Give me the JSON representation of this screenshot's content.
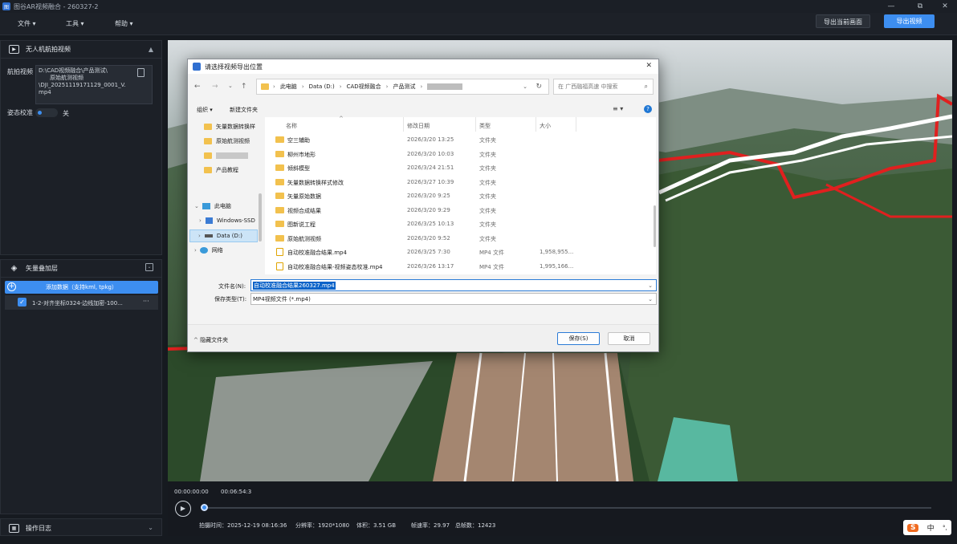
{
  "app": {
    "title": "图谷AR视频融合 - 260327-2"
  },
  "menu": {
    "items": [
      "文件 ▾",
      "工具 ▾",
      "帮助 ▾"
    ]
  },
  "top_buttons": {
    "export_frame": "导出当前画面",
    "export_video": "导出视频"
  },
  "panel_video": {
    "title": "无人机航拍视频",
    "video_label": "航拍视频",
    "video_path_lines": [
      "D:\\CAD视频融合\\产品测试\\",
      "原始航测视频",
      "\\DJI_20251119171129_0001_V.",
      "mp4"
    ],
    "attitude_label": "姿态校准",
    "attitude_state": "关"
  },
  "panel_layers": {
    "title": "矢量叠加层",
    "add_button": "添加数据（支持kml, tpkg）",
    "layer_item": "1-2-对齐坐标0324-边线加密-100...",
    "layer_more": "···"
  },
  "panel_log": {
    "title": "操作日志"
  },
  "player": {
    "current_time": "00:00:00:00",
    "total_time": "00:06:54:3",
    "progress": 0.0,
    "info": {
      "capture_time": "拍摄时间：2025-12-19 08:16:36",
      "resolution": "分辨率：1920*1080",
      "size": "体积：3.51 GB",
      "fps": "帧速率：29.97",
      "frames": "总帧数：12423"
    }
  },
  "dialog": {
    "title": "请选择视频导出位置",
    "address": [
      "此电脑",
      "Data (D:)",
      "CAD视频融合",
      "产品测试"
    ],
    "search_placeholder": "在 广西融福高速 中搜索",
    "toolbar": {
      "organize": "组织 ▾",
      "new_folder": "新建文件夹"
    },
    "nav": [
      {
        "label": "矢量数据转换样",
        "type": "folder"
      },
      {
        "label": "原始航测视频",
        "type": "folder"
      },
      {
        "label": "",
        "type": "folder"
      },
      {
        "label": "产品教程",
        "type": "folder"
      },
      {
        "label": "此电脑",
        "type": "pc"
      },
      {
        "label": "Windows-SSD",
        "type": "drive"
      },
      {
        "label": "Data (D:)",
        "type": "drive"
      },
      {
        "label": "网络",
        "type": "network"
      }
    ],
    "columns": [
      "名称",
      "修改日期",
      "类型",
      "大小"
    ],
    "files": [
      {
        "name": "空三辅助",
        "date": "2026/3/20 13:25",
        "type": "文件夹",
        "size": "",
        "kind": "folder"
      },
      {
        "name": "柳州市地形",
        "date": "2026/3/20 10:03",
        "type": "文件夹",
        "size": "",
        "kind": "folder"
      },
      {
        "name": "倾斜模型",
        "date": "2026/3/24 21:51",
        "type": "文件夹",
        "size": "",
        "kind": "folder"
      },
      {
        "name": "矢量数据转换样式修改",
        "date": "2026/3/27 10:39",
        "type": "文件夹",
        "size": "",
        "kind": "folder"
      },
      {
        "name": "矢量原始数据",
        "date": "2026/3/20 9:25",
        "type": "文件夹",
        "size": "",
        "kind": "folder"
      },
      {
        "name": "视频合成结果",
        "date": "2026/3/20 9:29",
        "type": "文件夹",
        "size": "",
        "kind": "folder"
      },
      {
        "name": "图新说工程",
        "date": "2026/3/25 10:13",
        "type": "文件夹",
        "size": "",
        "kind": "folder"
      },
      {
        "name": "原始航测视频",
        "date": "2026/3/20 9:52",
        "type": "文件夹",
        "size": "",
        "kind": "folder"
      },
      {
        "name": "自动校准融合结果.mp4",
        "date": "2026/3/25 7:30",
        "type": "MP4 文件",
        "size": "1,958,955...",
        "kind": "mp4"
      },
      {
        "name": "自动校准融合结果-视频姿态校准.mp4",
        "date": "2026/3/26 13:17",
        "type": "MP4 文件",
        "size": "1,995,166...",
        "kind": "mp4"
      }
    ],
    "filename_label": "文件名(N):",
    "filename_value": "自动校准融合结果260327.mp4",
    "filetype_label": "保存类型(T):",
    "filetype_value": "MP4视频文件 (*.mp4)",
    "hide_folders": "隐藏文件夹",
    "save": "保存(S)",
    "cancel": "取消"
  },
  "ime": {
    "sogou": "S",
    "mode": "中",
    "punct": "°,"
  }
}
